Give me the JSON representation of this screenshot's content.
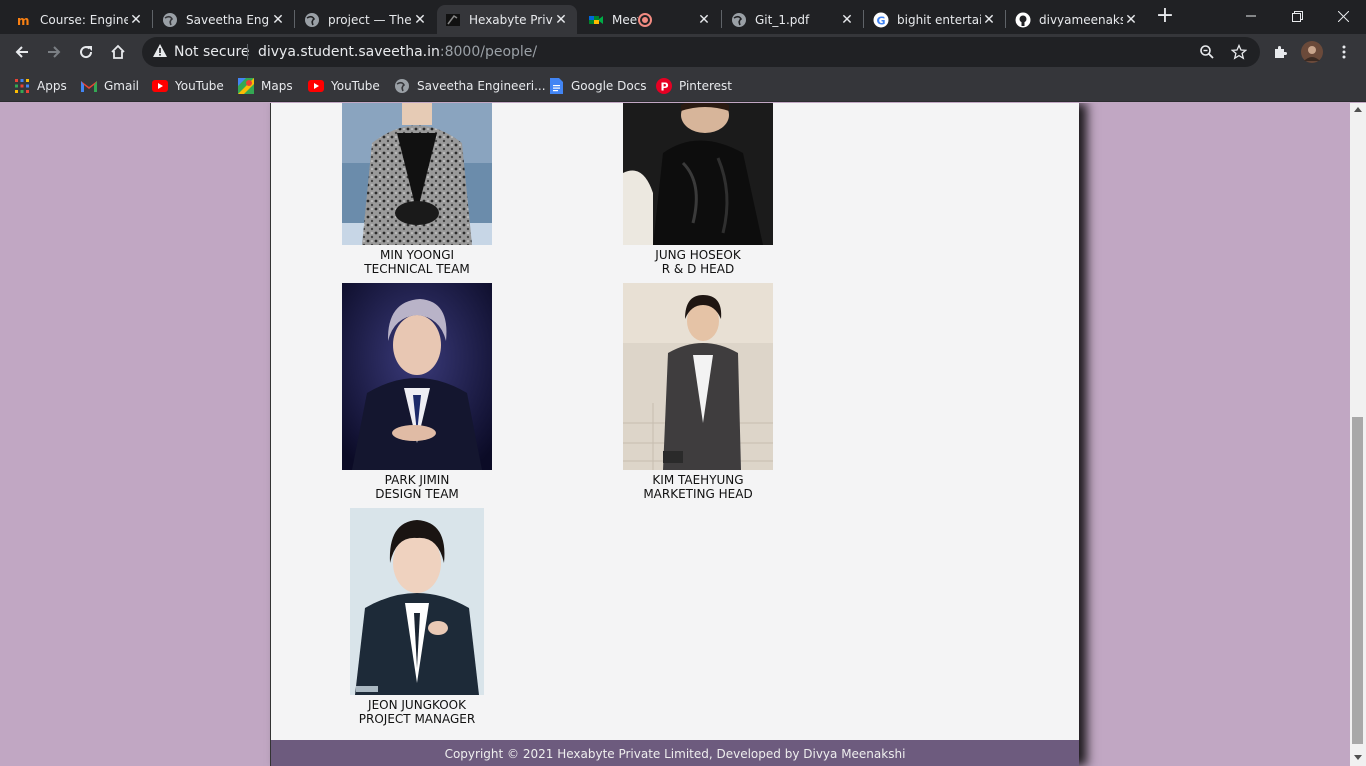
{
  "browser": {
    "tabs": [
      {
        "title": "Course: Enginee",
        "icon": "moodle-icon",
        "active": false
      },
      {
        "title": "Saveetha Engine",
        "icon": "globe-icon",
        "active": false
      },
      {
        "title": "project — The F",
        "icon": "globe-icon",
        "active": false
      },
      {
        "title": "Hexabyte Private",
        "icon": "page-icon",
        "active": true
      },
      {
        "title": "Meet - ihn",
        "icon": "meet-icon",
        "active": false
      },
      {
        "title": "Git_1.pdf",
        "icon": "globe-icon",
        "active": false
      },
      {
        "title": "bighit entertain",
        "icon": "google-icon",
        "active": false
      },
      {
        "title": "divyameenaksh",
        "icon": "github-icon",
        "active": false
      }
    ],
    "security_label": "Not secure",
    "url_host": "divya.student.saveetha.in",
    "url_path": ":8000/people/",
    "bookmarks": [
      {
        "label": "Apps",
        "icon": "apps-grid-icon"
      },
      {
        "label": "Gmail",
        "icon": "gmail-icon"
      },
      {
        "label": "YouTube",
        "icon": "youtube-icon"
      },
      {
        "label": "Maps",
        "icon": "maps-icon"
      },
      {
        "label": "YouTube",
        "icon": "youtube-icon"
      },
      {
        "label": "Saveetha Engineeri...",
        "icon": "globe-icon"
      },
      {
        "label": "Google Docs",
        "icon": "docs-icon"
      },
      {
        "label": "Pinterest",
        "icon": "pinterest-icon"
      }
    ]
  },
  "people": [
    {
      "name": "MIN YOONGI",
      "role": "TECHNICAL TEAM"
    },
    {
      "name": "JUNG HOSEOK",
      "role": "R & D HEAD"
    },
    {
      "name": "PARK JIMIN",
      "role": "DESIGN TEAM"
    },
    {
      "name": "KIM TAEHYUNG",
      "role": "MARKETING HEAD"
    },
    {
      "name": "JEON JUNGKOOK",
      "role": "PROJECT MANAGER"
    }
  ],
  "footer": {
    "text": "Copyright © 2021 Hexabyte Private Limited, Developed by Divya Meenakshi"
  },
  "colors": {
    "page_background": "#c1a7c3",
    "content_background": "#f4f4f5",
    "footer_background": "#6d5b7e",
    "chrome_dark": "#202124",
    "chrome_toolbar": "#35363a"
  }
}
